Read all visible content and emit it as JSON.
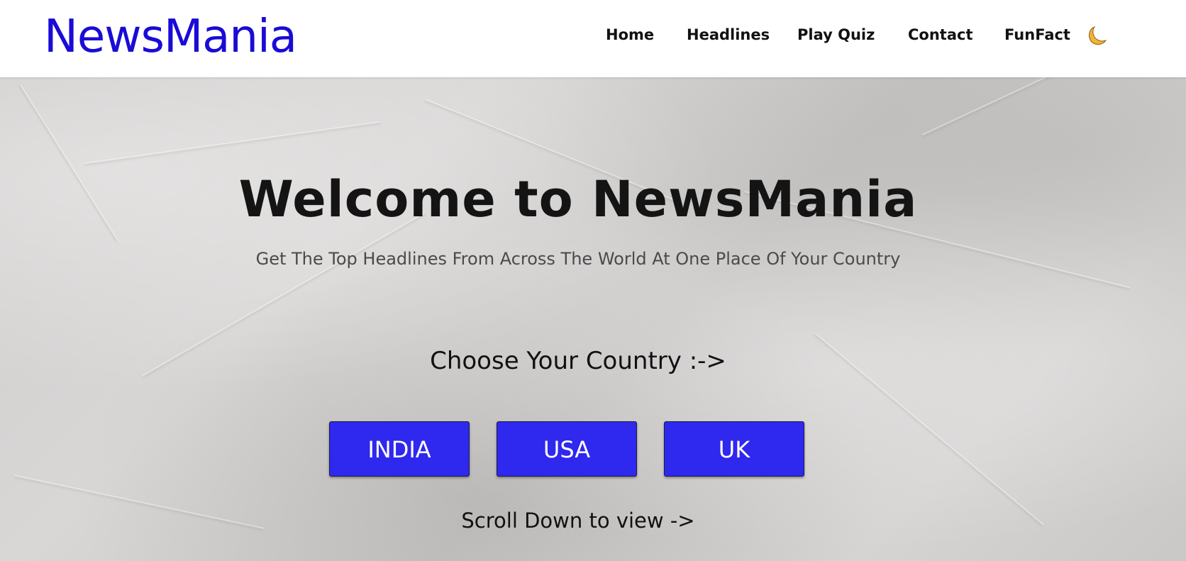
{
  "header": {
    "logo": "NewsMania",
    "nav": {
      "home": "Home",
      "headlines": "Headlines",
      "play_quiz": "Play Quiz",
      "contact": "Contact",
      "funfact": "FunFact"
    },
    "theme_toggle_icon": "moon-icon"
  },
  "hero": {
    "title": "Welcome to NewsMania",
    "subtitle": "Get The Top Headlines From Across The World At One Place Of Your Country",
    "choose_label": "Choose Your Country :->",
    "countries": {
      "india": "INDIA",
      "usa": "USA",
      "uk": "UK"
    },
    "scroll_hint": "Scroll Down to view ->"
  },
  "colors": {
    "logo": "#1a0bd6",
    "button_bg": "#2f28ee",
    "button_text": "#ffffff",
    "moon": "#f2b33a",
    "hero_bg": "#d2d0cf"
  }
}
